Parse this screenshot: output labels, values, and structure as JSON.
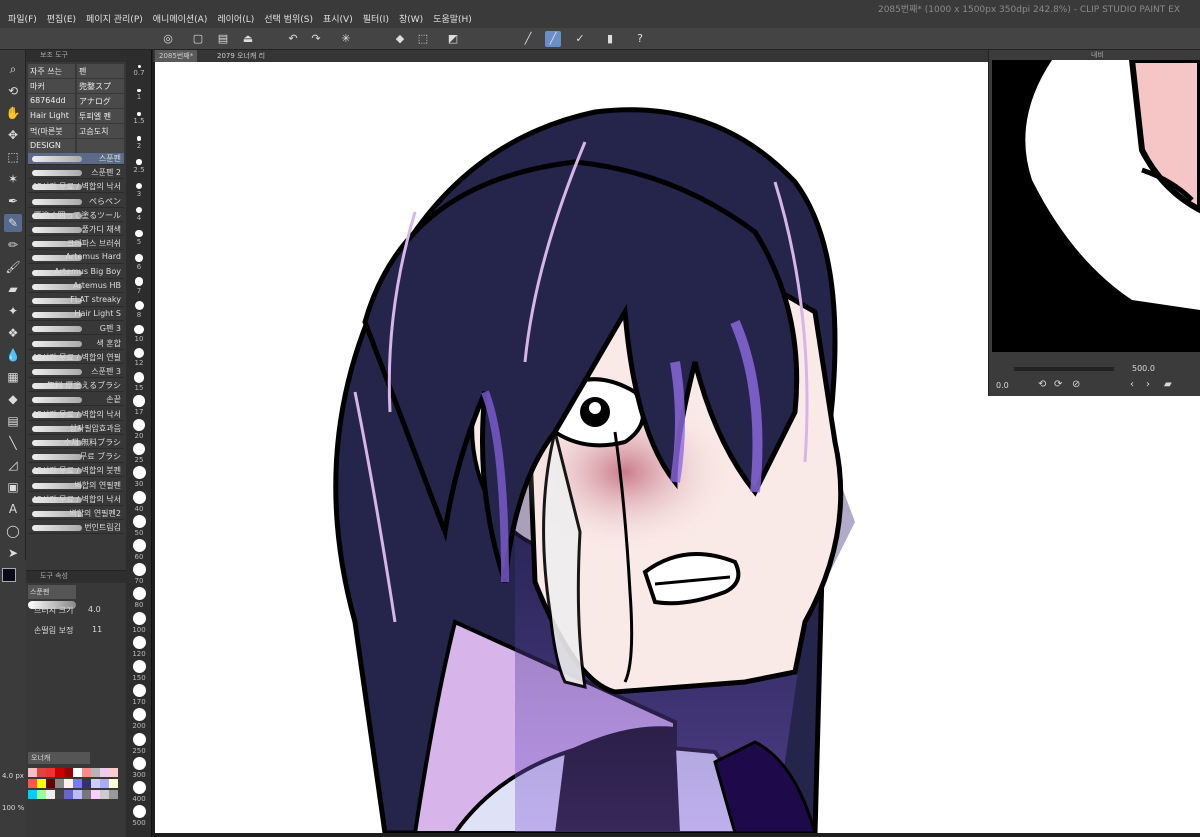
{
  "window": {
    "title": "2085번째* (1000 x 1500px 350dpi 242.8%) - CLIP STUDIO PAINT EX"
  },
  "menu": [
    "파일(F)",
    "편집(E)",
    "페이지 관리(P)",
    "애니메이션(A)",
    "레이어(L)",
    "선택 범위(S)",
    "표시(V)",
    "필터(I)",
    "창(W)",
    "도움말(H)"
  ],
  "tabs": [
    "2085번째*",
    "2079 오너캐 리"
  ],
  "subtool": {
    "header": "보조 도구",
    "grid": [
      [
        "자주 쓰는",
        "펜"
      ],
      [
        "마커",
        "兜鍪スプ"
      ],
      [
        "68764dd",
        "アナログ"
      ],
      [
        "Hair Light",
        "투피엘 펜"
      ],
      [
        "먹(마른붓",
        "고슴도치"
      ],
      [
        "DESIGN",
        ""
      ]
    ],
    "brushes": [
      "스푼펜",
      "스푼펜 2",
      "48시간 무료 / 벽합의 낙서",
      "ぺらペン",
      "厚塗く囲って塗るツール",
      "풀가디 채색",
      "크레파스 브러쉬",
      "Artemus Hard",
      "Artemus Big Boy",
      "Artemus HB",
      "FLAT streaky",
      "Hair Light S",
      "G펜 3",
      "색 혼합",
      "48시간 무료 / 벽합의 연필",
      "스푼펜 3",
      "無料 厚塗えるブラシ",
      "손끝",
      "48시간 무료 / 벽합의 낙서",
      "상자필압효과음",
      "수채 無料ブラシ",
      "무료 ブラシ",
      "48시간 무료 / 벽합의 붓펜",
      "벽합의 연필펜",
      "48시간 무료 / 벽합의 낙서",
      "벽합의 연필펜2",
      "번인트림김"
    ]
  },
  "sizes": [
    "0.7",
    "1",
    "1.5",
    "2",
    "2.5",
    "3",
    "4",
    "5",
    "6",
    "7",
    "8",
    "10",
    "12",
    "15",
    "17",
    "20",
    "25",
    "30",
    "40",
    "50",
    "60",
    "70",
    "80",
    "100",
    "120",
    "150",
    "170",
    "200",
    "250",
    "300",
    "400",
    "500"
  ],
  "props": {
    "header": "도구 속성",
    "brush_name": "스푼펜",
    "brush_size_label": "브러시 크기",
    "brush_size": "4.0",
    "stab_label": "손떨림 보정",
    "stab": "11"
  },
  "color": {
    "set": "오너캐",
    "brush_px": "4.0 px",
    "opacity": "100 %"
  },
  "navigator": {
    "title": "내비",
    "zoom": "500.0",
    "angle": "0.0"
  },
  "colors": {
    "accent": "#6a8fc7",
    "hair": "#25244a",
    "headband": "#8ff0f0"
  }
}
